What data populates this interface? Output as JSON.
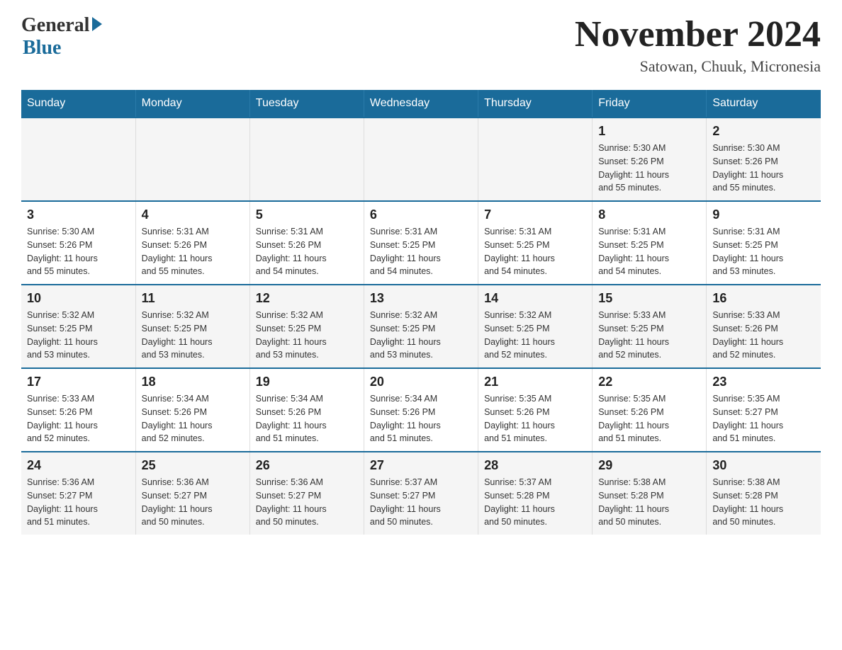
{
  "logo": {
    "general": "General",
    "blue": "Blue"
  },
  "title": "November 2024",
  "subtitle": "Satowan, Chuuk, Micronesia",
  "weekdays": [
    "Sunday",
    "Monday",
    "Tuesday",
    "Wednesday",
    "Thursday",
    "Friday",
    "Saturday"
  ],
  "weeks": [
    [
      {
        "day": "",
        "info": ""
      },
      {
        "day": "",
        "info": ""
      },
      {
        "day": "",
        "info": ""
      },
      {
        "day": "",
        "info": ""
      },
      {
        "day": "",
        "info": ""
      },
      {
        "day": "1",
        "info": "Sunrise: 5:30 AM\nSunset: 5:26 PM\nDaylight: 11 hours\nand 55 minutes."
      },
      {
        "day": "2",
        "info": "Sunrise: 5:30 AM\nSunset: 5:26 PM\nDaylight: 11 hours\nand 55 minutes."
      }
    ],
    [
      {
        "day": "3",
        "info": "Sunrise: 5:30 AM\nSunset: 5:26 PM\nDaylight: 11 hours\nand 55 minutes."
      },
      {
        "day": "4",
        "info": "Sunrise: 5:31 AM\nSunset: 5:26 PM\nDaylight: 11 hours\nand 55 minutes."
      },
      {
        "day": "5",
        "info": "Sunrise: 5:31 AM\nSunset: 5:26 PM\nDaylight: 11 hours\nand 54 minutes."
      },
      {
        "day": "6",
        "info": "Sunrise: 5:31 AM\nSunset: 5:25 PM\nDaylight: 11 hours\nand 54 minutes."
      },
      {
        "day": "7",
        "info": "Sunrise: 5:31 AM\nSunset: 5:25 PM\nDaylight: 11 hours\nand 54 minutes."
      },
      {
        "day": "8",
        "info": "Sunrise: 5:31 AM\nSunset: 5:25 PM\nDaylight: 11 hours\nand 54 minutes."
      },
      {
        "day": "9",
        "info": "Sunrise: 5:31 AM\nSunset: 5:25 PM\nDaylight: 11 hours\nand 53 minutes."
      }
    ],
    [
      {
        "day": "10",
        "info": "Sunrise: 5:32 AM\nSunset: 5:25 PM\nDaylight: 11 hours\nand 53 minutes."
      },
      {
        "day": "11",
        "info": "Sunrise: 5:32 AM\nSunset: 5:25 PM\nDaylight: 11 hours\nand 53 minutes."
      },
      {
        "day": "12",
        "info": "Sunrise: 5:32 AM\nSunset: 5:25 PM\nDaylight: 11 hours\nand 53 minutes."
      },
      {
        "day": "13",
        "info": "Sunrise: 5:32 AM\nSunset: 5:25 PM\nDaylight: 11 hours\nand 53 minutes."
      },
      {
        "day": "14",
        "info": "Sunrise: 5:32 AM\nSunset: 5:25 PM\nDaylight: 11 hours\nand 52 minutes."
      },
      {
        "day": "15",
        "info": "Sunrise: 5:33 AM\nSunset: 5:25 PM\nDaylight: 11 hours\nand 52 minutes."
      },
      {
        "day": "16",
        "info": "Sunrise: 5:33 AM\nSunset: 5:26 PM\nDaylight: 11 hours\nand 52 minutes."
      }
    ],
    [
      {
        "day": "17",
        "info": "Sunrise: 5:33 AM\nSunset: 5:26 PM\nDaylight: 11 hours\nand 52 minutes."
      },
      {
        "day": "18",
        "info": "Sunrise: 5:34 AM\nSunset: 5:26 PM\nDaylight: 11 hours\nand 52 minutes."
      },
      {
        "day": "19",
        "info": "Sunrise: 5:34 AM\nSunset: 5:26 PM\nDaylight: 11 hours\nand 51 minutes."
      },
      {
        "day": "20",
        "info": "Sunrise: 5:34 AM\nSunset: 5:26 PM\nDaylight: 11 hours\nand 51 minutes."
      },
      {
        "day": "21",
        "info": "Sunrise: 5:35 AM\nSunset: 5:26 PM\nDaylight: 11 hours\nand 51 minutes."
      },
      {
        "day": "22",
        "info": "Sunrise: 5:35 AM\nSunset: 5:26 PM\nDaylight: 11 hours\nand 51 minutes."
      },
      {
        "day": "23",
        "info": "Sunrise: 5:35 AM\nSunset: 5:27 PM\nDaylight: 11 hours\nand 51 minutes."
      }
    ],
    [
      {
        "day": "24",
        "info": "Sunrise: 5:36 AM\nSunset: 5:27 PM\nDaylight: 11 hours\nand 51 minutes."
      },
      {
        "day": "25",
        "info": "Sunrise: 5:36 AM\nSunset: 5:27 PM\nDaylight: 11 hours\nand 50 minutes."
      },
      {
        "day": "26",
        "info": "Sunrise: 5:36 AM\nSunset: 5:27 PM\nDaylight: 11 hours\nand 50 minutes."
      },
      {
        "day": "27",
        "info": "Sunrise: 5:37 AM\nSunset: 5:27 PM\nDaylight: 11 hours\nand 50 minutes."
      },
      {
        "day": "28",
        "info": "Sunrise: 5:37 AM\nSunset: 5:28 PM\nDaylight: 11 hours\nand 50 minutes."
      },
      {
        "day": "29",
        "info": "Sunrise: 5:38 AM\nSunset: 5:28 PM\nDaylight: 11 hours\nand 50 minutes."
      },
      {
        "day": "30",
        "info": "Sunrise: 5:38 AM\nSunset: 5:28 PM\nDaylight: 11 hours\nand 50 minutes."
      }
    ]
  ]
}
